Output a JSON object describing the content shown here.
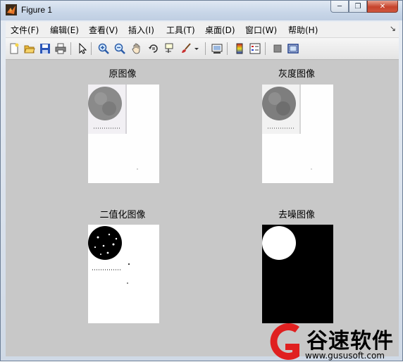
{
  "window": {
    "title": "Figure 1",
    "controls": [
      "─",
      "❐",
      "✕"
    ]
  },
  "menubar": {
    "items": [
      {
        "label": "文件(F)"
      },
      {
        "label": "编辑(E)"
      },
      {
        "label": "查看(V)"
      },
      {
        "label": "插入(I)"
      },
      {
        "label": "工具(T)"
      },
      {
        "label": "桌面(D)"
      },
      {
        "label": "窗口(W)"
      },
      {
        "label": "帮助(H)"
      }
    ],
    "dock_arrow": "↘"
  },
  "toolbar": {
    "icons": [
      "new-figure-icon",
      "open-file-icon",
      "save-icon",
      "print-icon",
      "pointer-icon",
      "zoom-in-icon",
      "zoom-out-icon",
      "pan-hand-icon",
      "rotate-3d-icon",
      "data-cursor-icon",
      "brush-icon",
      "dropdown-arrow-icon",
      "link-plot-icon",
      "colorbar-icon",
      "legend-icon",
      "hide-plot-tools-icon",
      "show-plot-tools-icon"
    ]
  },
  "subplots": [
    {
      "title": "原图像"
    },
    {
      "title": "灰度图像"
    },
    {
      "title": "二值化图像"
    },
    {
      "title": "去噪图像"
    }
  ],
  "watermark": {
    "brand": "谷速软件",
    "url": "www.gususoft.com",
    "color": "#e02020"
  }
}
